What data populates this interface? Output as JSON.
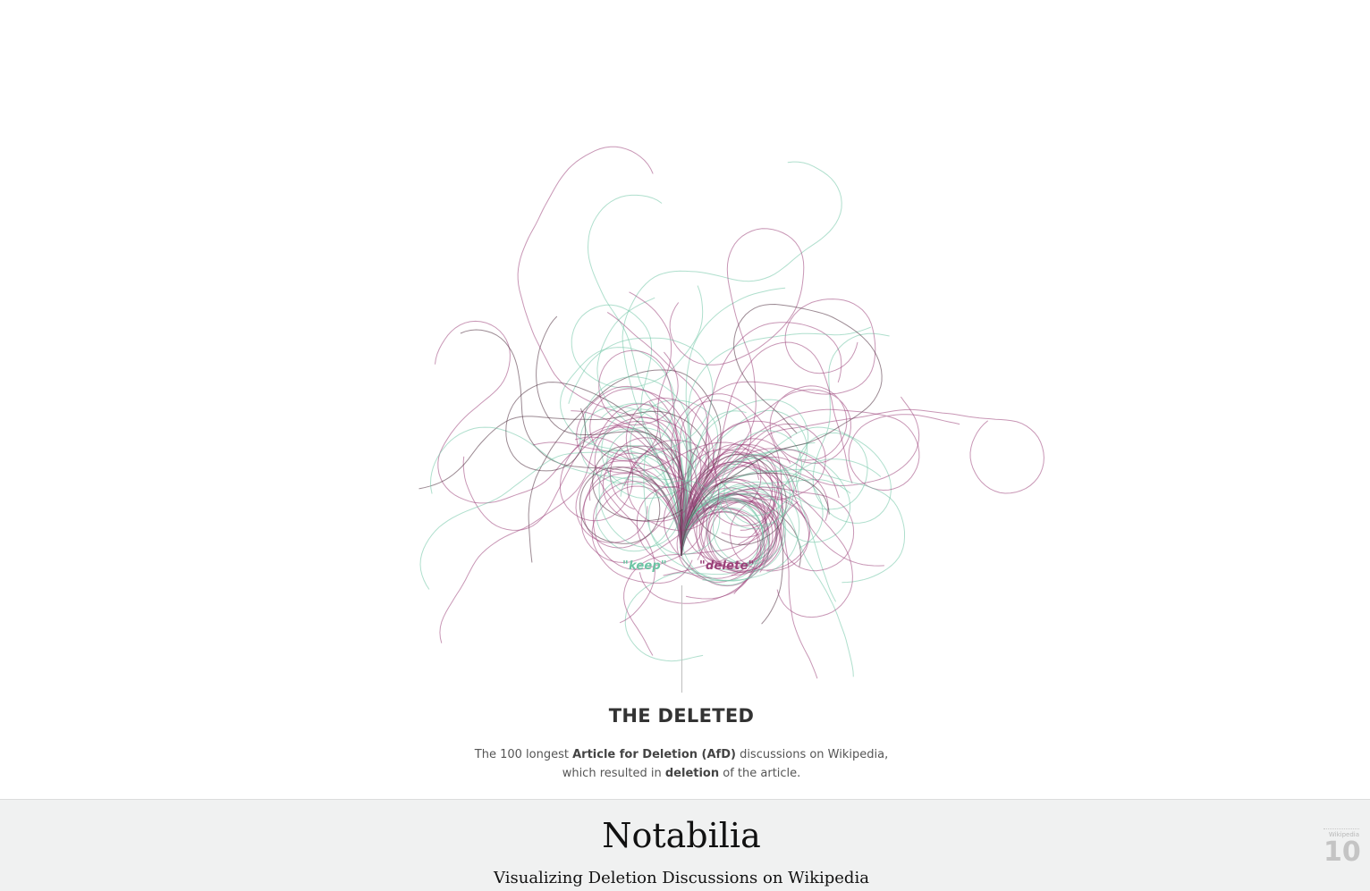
{
  "visualization": {
    "keep_label": "\"keep\"",
    "delete_label": "\"delete\"",
    "colors": {
      "keep": "#6dc4a4",
      "delete": "#9a3f78",
      "mixed": "#4a2a3a"
    },
    "discussion_count": 100
  },
  "section": {
    "title": "THE DELETED",
    "desc_part1": "The 100 longest ",
    "desc_bold1": "Article for Deletion (AfD)",
    "desc_part2": " discussions on Wikipedia,",
    "desc_part3": "which resulted in ",
    "desc_bold2": "deletion",
    "desc_part4": " of the article."
  },
  "footer": {
    "title": "Notabilia",
    "subtitle": "Visualizing Deletion Discussions on Wikipedia",
    "badge_small": "Wikipedia",
    "badge_number": "10",
    "background": "#f0f1f1"
  }
}
